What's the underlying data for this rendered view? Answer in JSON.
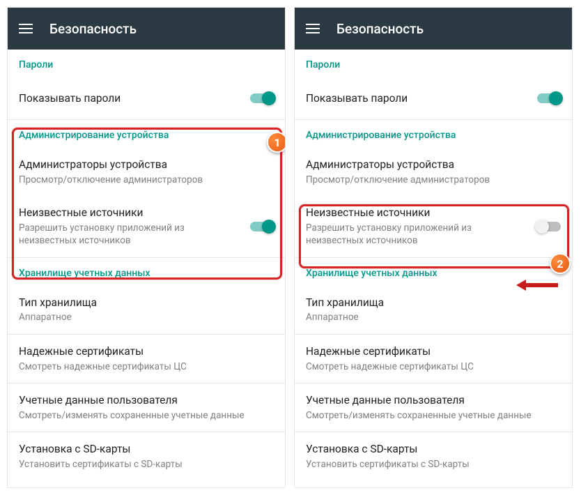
{
  "appbar": {
    "title": "Безопасность"
  },
  "sections": {
    "passwords": {
      "header": "Пароли",
      "show_passwords": "Показывать пароли"
    },
    "admin": {
      "header": "Администрирование устройства",
      "device_admins": {
        "title": "Администраторы устройства",
        "sub": "Просмотр/отключение администраторов"
      },
      "unknown_sources": {
        "title": "Неизвестные источники",
        "sub": "Разрешить установку приложений из неизвестных источников"
      }
    },
    "creds": {
      "header": "Хранилище учетных данных",
      "storage_type": {
        "title": "Тип хранилища",
        "sub": "Аппаратное"
      },
      "trusted_certs": {
        "title": "Надежные сертификаты",
        "sub": "Смотреть надежные сертификаты ЦС"
      },
      "user_creds": {
        "title": "Учетные данные пользователя",
        "sub": "Смотреть/изменять сохраненные учетные данные"
      },
      "sd_install": {
        "title": "Установка с SD-карты",
        "sub": "Установить сертификаты с SD-карты"
      }
    }
  },
  "badges": {
    "one": "1",
    "two": "2"
  }
}
